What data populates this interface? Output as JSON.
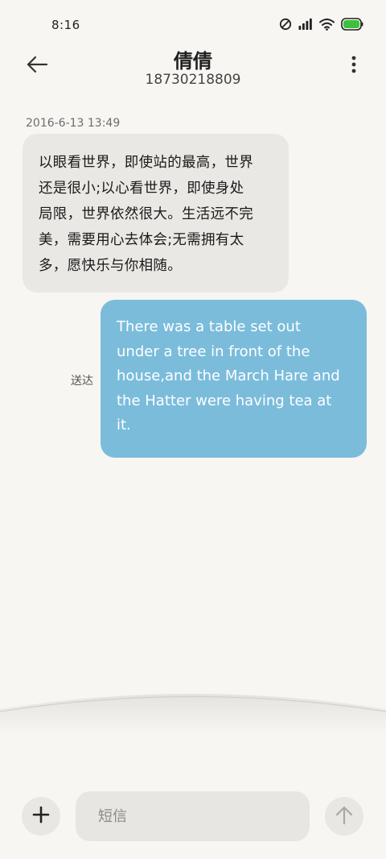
{
  "status_bar": {
    "time": "8:16",
    "icons": [
      "do-not-disturb-icon",
      "signal-icon",
      "wifi-icon",
      "battery-icon"
    ],
    "battery_color": "#3fbf3f"
  },
  "header": {
    "contact_name": "倩倩",
    "contact_number": "18730218809",
    "back_icon": "back-arrow-icon",
    "more_icon": "more-vertical-icon"
  },
  "messages": [
    {
      "direction": "incoming",
      "timestamp": "2016-6-13 13:49",
      "text_lines": [
        "以眼看世界，即使站的最高，世界",
        "还是很小;以心看世界，即使身处",
        "局限，世界依然很大。生活远不完",
        "美，需要用心去体会;无需拥有太",
        "多，愿快乐与你相随。"
      ]
    },
    {
      "direction": "outgoing",
      "status": "送达",
      "text_lines": [
        "There was a table set out",
        "under a tree in front of the",
        "house,and the March Hare and",
        "the Hatter were having tea at",
        "it."
      ]
    }
  ],
  "composer": {
    "placeholder": "短信",
    "add_icon": "plus-icon",
    "send_icon": "send-arrow-icon"
  },
  "colors": {
    "background": "#f7f6f3",
    "incoming_bubble": "#e9e8e4",
    "outgoing_bubble": "#7bbcdb"
  }
}
